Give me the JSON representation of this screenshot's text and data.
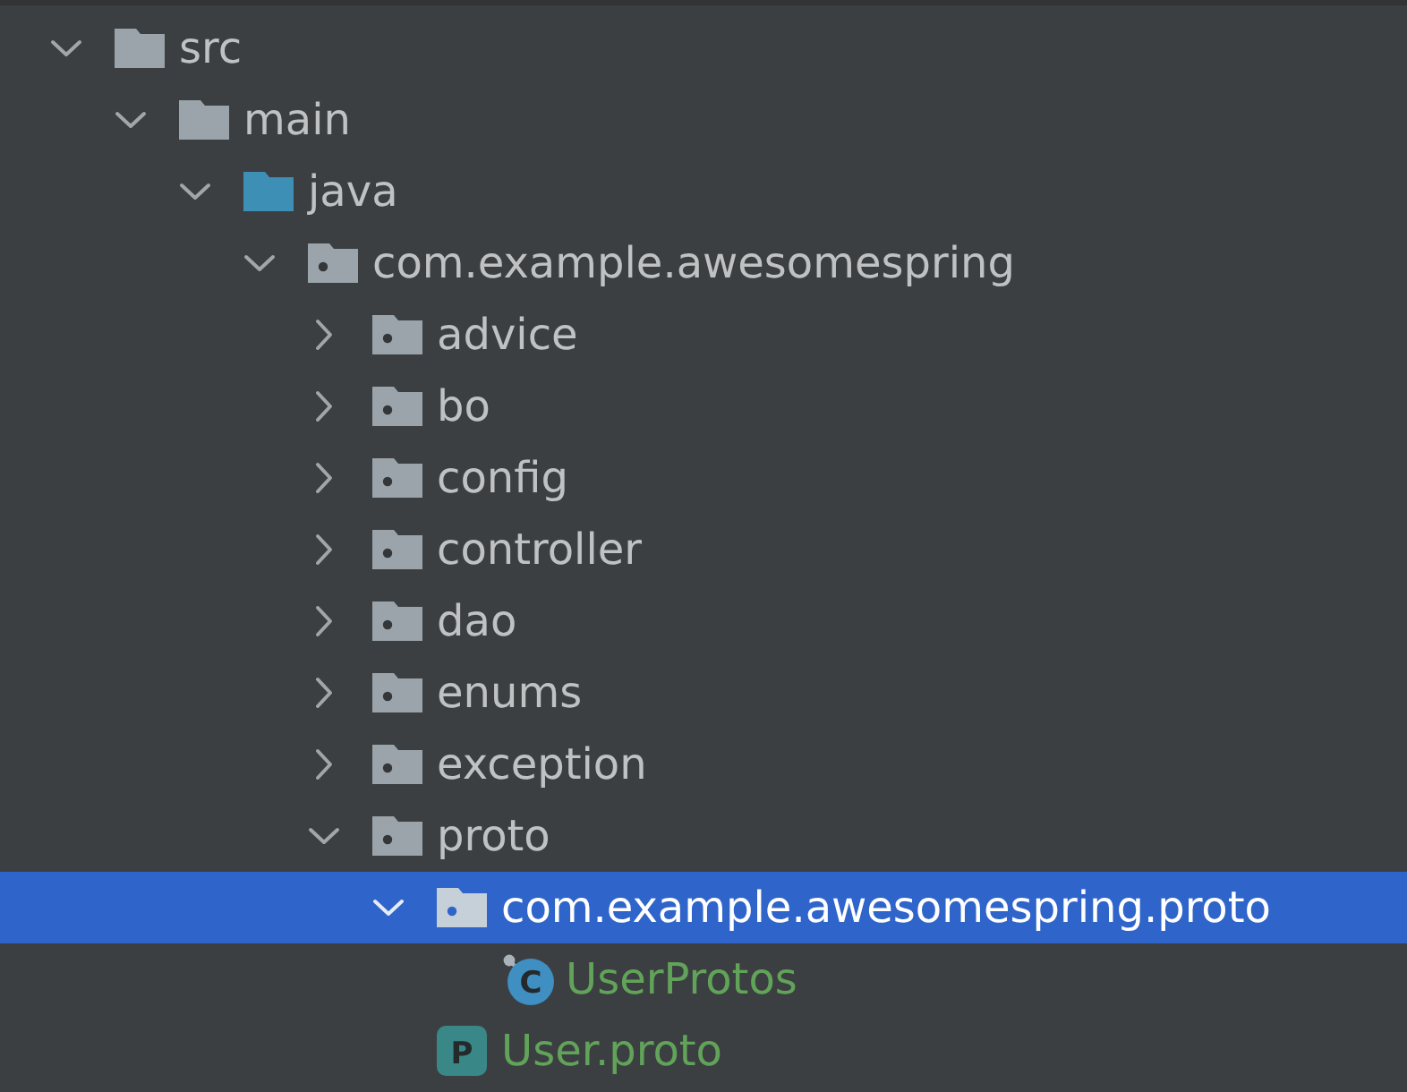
{
  "tree": [
    {
      "label": "src",
      "kind": "folder",
      "expanded": true,
      "selected": false,
      "added": false,
      "children": [
        {
          "label": "main",
          "kind": "folder",
          "expanded": true,
          "selected": false,
          "added": false,
          "children": [
            {
              "label": "java",
              "kind": "source-folder",
              "expanded": true,
              "selected": false,
              "added": false,
              "children": [
                {
                  "label": "com.example.awesomespring",
                  "kind": "package",
                  "expanded": true,
                  "selected": false,
                  "added": false,
                  "children": [
                    {
                      "label": "advice",
                      "kind": "package",
                      "expanded": false,
                      "selected": false,
                      "added": false
                    },
                    {
                      "label": "bo",
                      "kind": "package",
                      "expanded": false,
                      "selected": false,
                      "added": false
                    },
                    {
                      "label": "config",
                      "kind": "package",
                      "expanded": false,
                      "selected": false,
                      "added": false
                    },
                    {
                      "label": "controller",
                      "kind": "package",
                      "expanded": false,
                      "selected": false,
                      "added": false
                    },
                    {
                      "label": "dao",
                      "kind": "package",
                      "expanded": false,
                      "selected": false,
                      "added": false
                    },
                    {
                      "label": "enums",
                      "kind": "package",
                      "expanded": false,
                      "selected": false,
                      "added": false
                    },
                    {
                      "label": "exception",
                      "kind": "package",
                      "expanded": false,
                      "selected": false,
                      "added": false
                    },
                    {
                      "label": "proto",
                      "kind": "package",
                      "expanded": true,
                      "selected": false,
                      "added": false,
                      "children": [
                        {
                          "label": "com.example.awesomespring.proto",
                          "kind": "package",
                          "expanded": true,
                          "selected": true,
                          "added": false,
                          "children": [
                            {
                              "label": "UserProtos",
                              "kind": "class",
                              "badge": "C",
                              "selected": false,
                              "added": true
                            }
                          ]
                        },
                        {
                          "label": "User.proto",
                          "kind": "proto-file",
                          "badge": "P",
                          "selected": false,
                          "added": true
                        }
                      ]
                    }
                  ]
                }
              ]
            }
          ]
        }
      ]
    }
  ]
}
